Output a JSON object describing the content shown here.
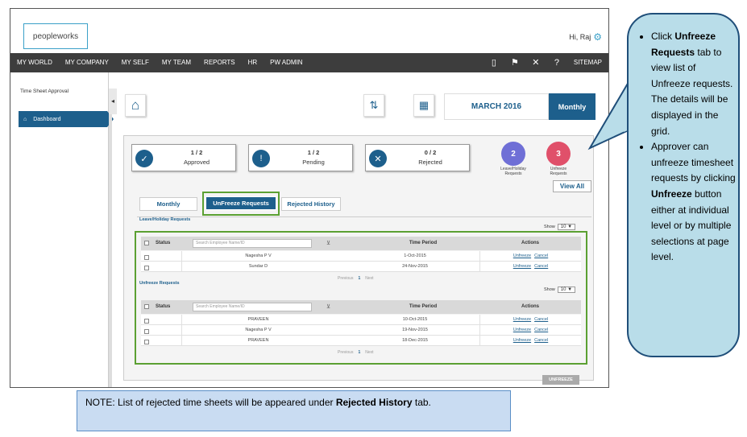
{
  "app": {
    "logo": "peopleworks",
    "greeting": "Hi, Raj"
  },
  "nav": {
    "items": [
      "MY WORLD",
      "MY COMPANY",
      "MY SELF",
      "MY TEAM",
      "REPORTS",
      "HR",
      "PW ADMIN"
    ],
    "sitemap": "SITEMAP"
  },
  "sidebar": {
    "label": "Time Sheet Approval",
    "dashboard": "Dashboard"
  },
  "header": {
    "month": "MARCH 2016",
    "view": "Monthly"
  },
  "stats": {
    "approved": {
      "count": "1 / 2",
      "label": "Approved"
    },
    "pending": {
      "count": "1 / 2",
      "label": "Pending"
    },
    "rejected": {
      "count": "0 / 2",
      "label": "Rejected"
    }
  },
  "badges": {
    "leave": {
      "count": "2",
      "label1": "Leave/Holiday",
      "label2": "Requests",
      "color": "#6f6fd6"
    },
    "unfreeze": {
      "count": "3",
      "label1": "Unfreeze",
      "label2": "Requests",
      "color": "#e0506a"
    }
  },
  "view_all": "View All",
  "tabs": [
    "Monthly",
    "UnFreeze Requests",
    "Rejected History"
  ],
  "leave": {
    "title": "Leave/Holiday Requests",
    "show_label": "Show",
    "show_value": "10",
    "rows": [
      {
        "name": "Nagesha P V",
        "date": "1-Oct-2015"
      },
      {
        "name": "Sundar D",
        "date": "24-Nov-2015"
      }
    ]
  },
  "unfreeze": {
    "title": "Unfreeze Requests",
    "show_label": "Show",
    "show_value": "10",
    "rows": [
      {
        "name": "PRAVEEN",
        "date": "10-Oct-2015"
      },
      {
        "name": "Nagesha P V",
        "date": "19-Nov-2015"
      },
      {
        "name": "PRAVEEN",
        "date": "18-Dec-2015"
      }
    ]
  },
  "grid": {
    "status": "Status",
    "search_placeholder": "Search Employee Name/ID",
    "time_period": "Time Period",
    "actions": "Actions",
    "unfreeze_link": "Unfreeze",
    "cancel_link": "Cancel",
    "prev": "Previous",
    "page": "1",
    "next": "Next"
  },
  "unfreeze_button": "UNFREEZE",
  "callout": {
    "b1_pre": "Click ",
    "b1_bold": "Unfreeze Requests",
    "b1_post": " tab to view list of Unfreeze requests. The details will be displayed in the grid.",
    "b2_pre": "Approver can unfreeze timesheet requests by clicking ",
    "b2_bold": "Unfreeze",
    "b2_post": " button either at individual level or by multiple selections at page level."
  },
  "note": {
    "pre": "NOTE: List of rejected time sheets will be appeared under ",
    "bold": "Rejected History",
    "post": " tab."
  },
  "colors": {
    "primary": "#1d5f8c",
    "highlight": "#5ba032",
    "callout_bg": "#b9dde9",
    "note_bg": "#c9dcf2"
  }
}
